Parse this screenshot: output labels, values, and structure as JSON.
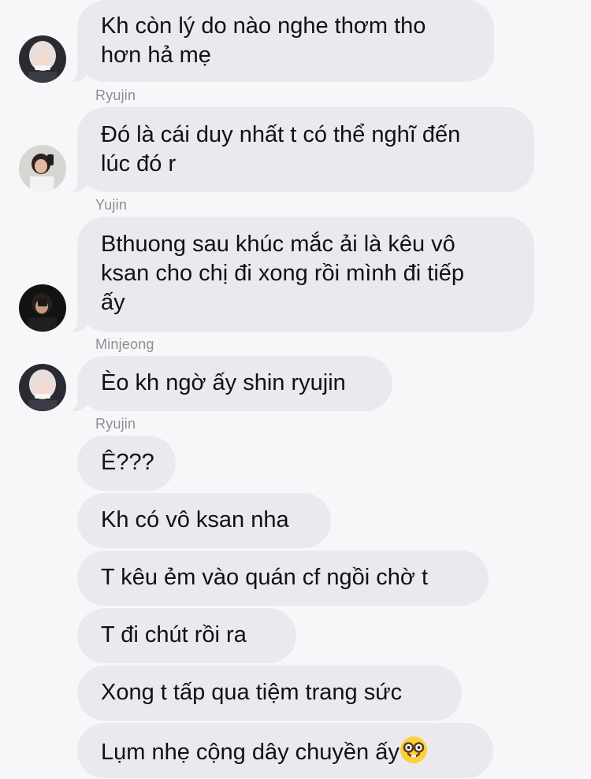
{
  "messages": [
    {
      "sender": "",
      "lines": [
        "Kh còn lý do nào nghe thơm tho",
        "hơn hả mẹ"
      ]
    },
    {
      "sender": "Ryujin",
      "lines": [
        "Đó là cái duy nhất t có thể nghĩ đến",
        "lúc đó r"
      ]
    },
    {
      "sender": "Yujin",
      "lines": [
        "Bthuong sau khúc mắc ải là kêu vô",
        "ksan cho chị đi xong rồi mình đi tiếp",
        "ấy"
      ]
    },
    {
      "sender": "Minjeong",
      "lines": [
        "Èo kh ngờ ấy shin ryujin"
      ]
    },
    {
      "sender": "Ryujin",
      "group": [
        "Ê???",
        "Kh có vô ksan nha",
        "T kêu ẻm vào quán cf ngồi chờ t",
        "T đi chút rồi ra",
        "Xong t tấp qua tiệm trang sức",
        "Lụm nhẹ cộng dây chuyền ấy"
      ],
      "last_emoji": "nerd-face-emoji"
    }
  ],
  "avatars": {
    "ryujin": "avatar-ryujin",
    "yujin": "avatar-yujin",
    "minjeong": "avatar-minjeong"
  },
  "colors": {
    "background": "#f7f7f9",
    "bubble": "#e9e9ee",
    "sender_name": "#8e8e93"
  }
}
